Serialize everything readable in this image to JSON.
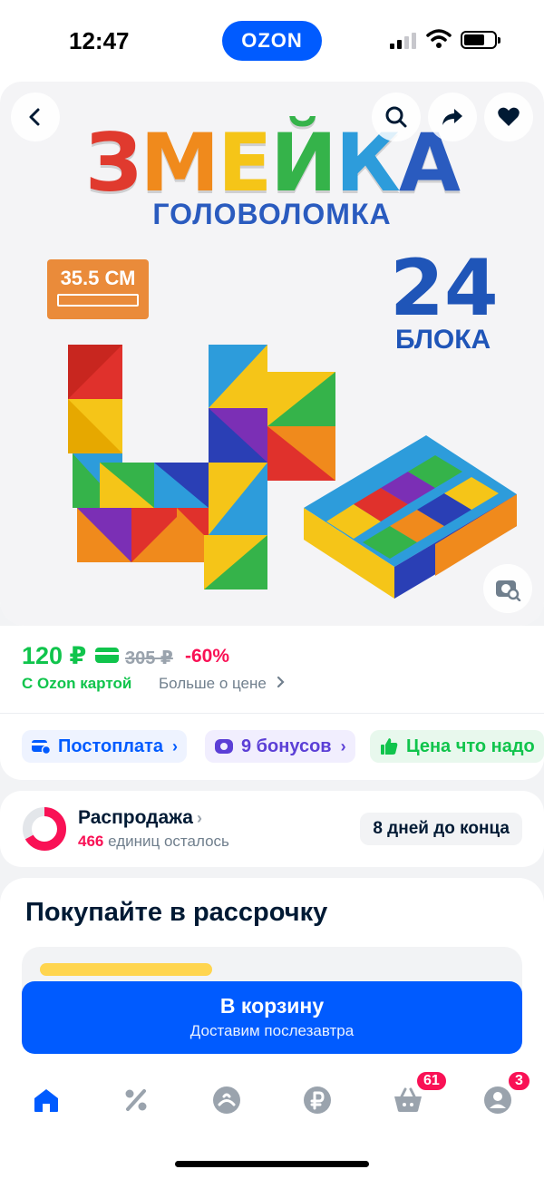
{
  "status_bar": {
    "time": "12:47",
    "center_logo": "OZON"
  },
  "hero": {
    "title_letters": [
      {
        "ch": "З",
        "color": "#e03a2e"
      },
      {
        "ch": "М",
        "color": "#f08a1c"
      },
      {
        "ch": "Е",
        "color": "#f5c518"
      },
      {
        "ch": "Й",
        "color": "#35b34a"
      },
      {
        "ch": "К",
        "color": "#2d9cdb"
      },
      {
        "ch": "А",
        "color": "#2a5bbf"
      }
    ],
    "subtitle": "ГОЛОВОЛОМКА",
    "size_badge": "35.5 СМ",
    "blocks_number": "24",
    "blocks_label": "БЛОКА"
  },
  "price": {
    "current": "120 ₽",
    "old": "305 ₽",
    "discount": "-60%",
    "ozon_card": "С Ozon картой",
    "more_about_price": "Больше о цене"
  },
  "chips": [
    {
      "label": "Постоплата",
      "icon": "card-clock-icon",
      "bg": "#eef3ff",
      "color": "#005bff"
    },
    {
      "label": "9 бонусов",
      "icon": "bonus-icon",
      "bg": "#f1eefe",
      "color": "#5b3fd6"
    },
    {
      "label": "Цена что надо",
      "icon": "thumbs-up-icon",
      "bg": "#e8f8ed",
      "color": "#10c44c"
    }
  ],
  "sale": {
    "title": "Распродажа",
    "count": "466",
    "count_suffix": "единиц осталось",
    "days_left": "8 дней до конца"
  },
  "installment": {
    "title": "Покупайте в рассрочку"
  },
  "cart_button": {
    "label": "В корзину",
    "sublabel": "Доставим послезавтра"
  },
  "tabbar": {
    "items": [
      {
        "name": "home",
        "active": true
      },
      {
        "name": "discounts"
      },
      {
        "name": "fresh"
      },
      {
        "name": "finance"
      },
      {
        "name": "cart",
        "badge": "61"
      },
      {
        "name": "profile",
        "badge": "3"
      }
    ]
  },
  "colors": {
    "accent": "#005bff",
    "price_green": "#10c44c",
    "discount_pink": "#f91155"
  }
}
